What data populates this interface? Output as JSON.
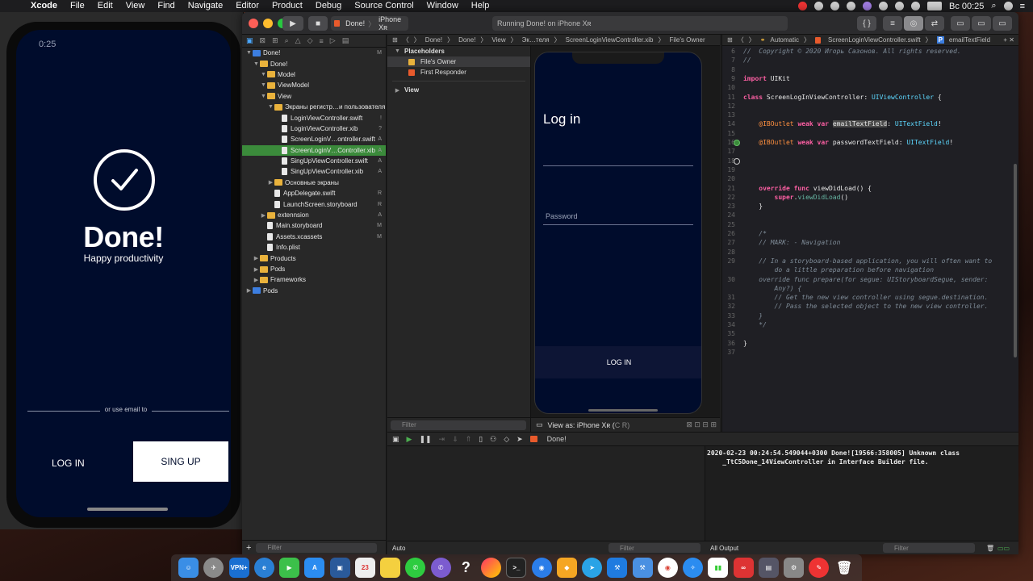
{
  "menubar": {
    "app": "Xcode",
    "menus": [
      "File",
      "Edit",
      "View",
      "Find",
      "Navigate",
      "Editor",
      "Product",
      "Debug",
      "Source Control",
      "Window",
      "Help"
    ],
    "clock": "Вс 00:25"
  },
  "simulator": {
    "time": "0:25",
    "brand": "Done!",
    "tagline": "Happy productivity",
    "divider_text": "or use email to",
    "login_label": "LOG IN",
    "signup_label": "SING UP"
  },
  "toolbar": {
    "scheme_target": "Done!",
    "scheme_device": "iPhone Xʀ",
    "status": "Running Done! on iPhone Xʀ"
  },
  "navigator": {
    "rows": [
      {
        "label": "Done!",
        "status": "M",
        "indent": 0,
        "kind": "project"
      },
      {
        "label": "Done!",
        "status": "",
        "indent": 1,
        "kind": "folder"
      },
      {
        "label": "Model",
        "status": "",
        "indent": 2,
        "kind": "folder"
      },
      {
        "label": "ViewModel",
        "status": "",
        "indent": 2,
        "kind": "folder"
      },
      {
        "label": "View",
        "status": "",
        "indent": 2,
        "kind": "folder"
      },
      {
        "label": "Экраны регистр…и пользователя",
        "status": "",
        "indent": 3,
        "kind": "folder"
      },
      {
        "label": "LoginViewController.swift",
        "status": "!",
        "indent": 4,
        "kind": "file"
      },
      {
        "label": "LoginViewController.xib",
        "status": "?",
        "indent": 4,
        "kind": "file"
      },
      {
        "label": "ScreenLoginV…ontroller.swift",
        "status": "A",
        "indent": 4,
        "kind": "file"
      },
      {
        "label": "ScreenLoginV…Controller.xib",
        "status": "A",
        "indent": 4,
        "kind": "file",
        "selected": true
      },
      {
        "label": "SingUpViewController.swift",
        "status": "A",
        "indent": 4,
        "kind": "file"
      },
      {
        "label": "SingUpViewController.xib",
        "status": "A",
        "indent": 4,
        "kind": "file"
      },
      {
        "label": "Основные экраны",
        "status": "",
        "indent": 3,
        "kind": "folder"
      },
      {
        "label": "AppDelegate.swift",
        "status": "R",
        "indent": 3,
        "kind": "file"
      },
      {
        "label": "LaunchScreen.storyboard",
        "status": "R",
        "indent": 3,
        "kind": "file"
      },
      {
        "label": "extennsion",
        "status": "A",
        "indent": 2,
        "kind": "folder"
      },
      {
        "label": "Main.storyboard",
        "status": "M",
        "indent": 2,
        "kind": "file"
      },
      {
        "label": "Assets.xcassets",
        "status": "M",
        "indent": 2,
        "kind": "file"
      },
      {
        "label": "Info.plist",
        "status": "",
        "indent": 2,
        "kind": "file"
      },
      {
        "label": "Products",
        "status": "",
        "indent": 1,
        "kind": "folder"
      },
      {
        "label": "Pods",
        "status": "",
        "indent": 1,
        "kind": "folder"
      },
      {
        "label": "Frameworks",
        "status": "",
        "indent": 1,
        "kind": "folder"
      },
      {
        "label": "Pods",
        "status": "",
        "indent": 0,
        "kind": "project"
      }
    ],
    "filter_placeholder": "Filter"
  },
  "ib": {
    "jump": [
      "Done!",
      "Done!",
      "View",
      "Эк…теля",
      "ScreenLoginViewController.xib",
      "File's Owner"
    ],
    "outline_header": "Placeholders",
    "outline_items": [
      "File's Owner",
      "First Responder"
    ],
    "outline_view": "View",
    "filter_placeholder": "Filter",
    "device_title": "Log in",
    "password_placeholder": "Password",
    "login_button": "LOG IN",
    "view_as": "View as: iPhone Xʀ (",
    "view_as_suffix": "C  R)"
  },
  "code": {
    "jump_mode": "Automatic",
    "jump_file": "ScreenLoginViewController.swift",
    "jump_symbol": "emailTextField",
    "lines": [
      {
        "n": "6",
        "html": "<span class='cm'>//  Copyright © 2020 Игорь Сазонов. All rights reserved.</span>"
      },
      {
        "n": "7",
        "html": "<span class='cm'>//</span>"
      },
      {
        "n": "8",
        "html": ""
      },
      {
        "n": "9",
        "html": "<span class='kw'>import</span> <span class='pl'>UIKit</span>"
      },
      {
        "n": "10",
        "html": ""
      },
      {
        "n": "11",
        "html": "<span class='kw'>class</span> <span class='pl'>ScreenLogInViewController: </span><span class='ty'>UIViewController</span><span class='pl'> {</span>"
      },
      {
        "n": "12",
        "html": ""
      },
      {
        "n": "13",
        "html": ""
      },
      {
        "n": "14",
        "html": "    <span class='at'>@IBOutlet</span> <span class='kw'>weak var</span> <span class='pl hl'>emailTextField</span><span class='pl'>: </span><span class='ty'>UITextField</span><span class='pl'>!</span>"
      },
      {
        "n": "15",
        "html": ""
      },
      {
        "n": "16",
        "html": "    <span class='at'>@IBOutlet</span> <span class='kw'>weak var</span> <span class='pl'>passwordTextField: </span><span class='ty'>UITextField</span><span class='pl'>!</span>"
      },
      {
        "n": "17",
        "html": ""
      },
      {
        "n": "18",
        "html": ""
      },
      {
        "n": "19",
        "html": ""
      },
      {
        "n": "20",
        "html": ""
      },
      {
        "n": "21",
        "html": "    <span class='kw'>override func</span> <span class='pl'>viewDidLoad() {</span>"
      },
      {
        "n": "22",
        "html": "        <span class='kw'>super</span><span class='pl'>.</span><span class='fn'>viewDidLoad</span><span class='pl'>()</span>"
      },
      {
        "n": "23",
        "html": "    <span class='pl'>}</span>"
      },
      {
        "n": "24",
        "html": ""
      },
      {
        "n": "25",
        "html": ""
      },
      {
        "n": "26",
        "html": "    <span class='cm'>/*</span>"
      },
      {
        "n": "27",
        "html": "    <span class='cm'>// MARK: - Navigation</span>"
      },
      {
        "n": "28",
        "html": ""
      },
      {
        "n": "29",
        "html": "    <span class='cm'>// In a storyboard-based application, you will often want to</span>"
      },
      {
        "n": "",
        "html": "        <span class='cm'>do a little preparation before navigation</span>"
      },
      {
        "n": "30",
        "html": "    <span class='cm'>override func prepare(for segue: UIStoryboardSegue, sender:</span>"
      },
      {
        "n": "",
        "html": "        <span class='cm'>Any?) {</span>"
      },
      {
        "n": "31",
        "html": "        <span class='cm'>// Get the new view controller using segue.destination.</span>"
      },
      {
        "n": "32",
        "html": "        <span class='cm'>// Pass the selected object to the new view controller.</span>"
      },
      {
        "n": "33",
        "html": "    <span class='cm'>}</span>"
      },
      {
        "n": "34",
        "html": "    <span class='cm'>*/</span>"
      },
      {
        "n": "35",
        "html": ""
      },
      {
        "n": "36",
        "html": "<span class='pl'>}</span>"
      },
      {
        "n": "37",
        "html": ""
      }
    ]
  },
  "debug": {
    "target": "Done!",
    "console": "2020-02-23 00:24:54.549044+0300 Done![19566:358005] Unknown class\n    _TtC5Done_14ViewController in Interface Builder file.",
    "vars_mode": "Auto",
    "output_mode": "All Output",
    "filter_placeholder": "Filter"
  },
  "dock": {
    "vpn_label": "VPN+",
    "calendar_day": "23"
  },
  "colors": {
    "app_bg": "#000c2c",
    "selection_green": "#3b8b3b"
  }
}
